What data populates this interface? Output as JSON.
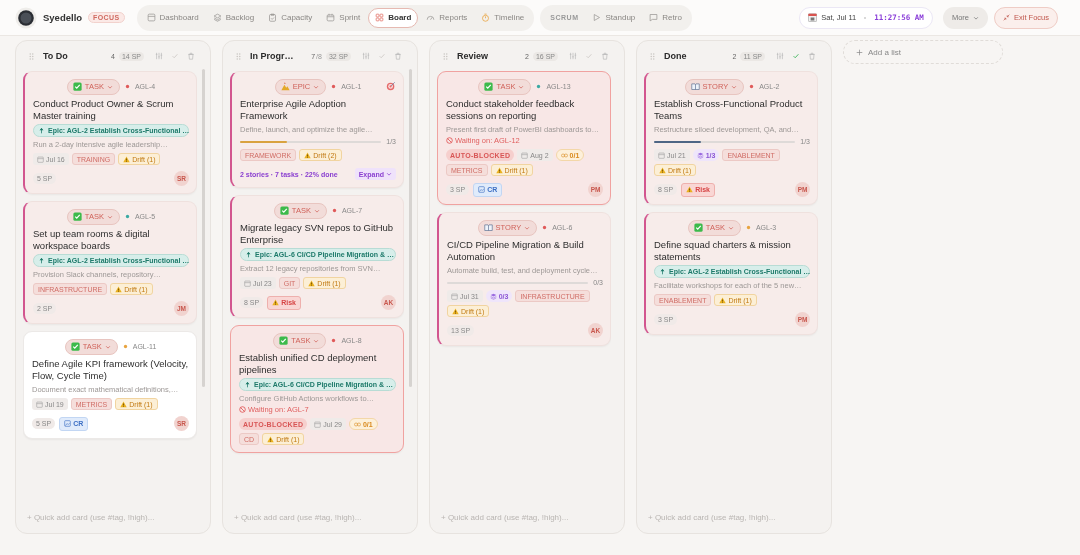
{
  "app": {
    "brand": "Syedello",
    "badge": "FOCUS"
  },
  "nav": [
    {
      "label": "Dashboard",
      "selected": false
    },
    {
      "label": "Backlog",
      "selected": false
    },
    {
      "label": "Capacity",
      "selected": false
    },
    {
      "label": "Sprint",
      "selected": false
    },
    {
      "label": "Board",
      "selected": true
    },
    {
      "label": "Reports",
      "selected": false
    },
    {
      "label": "Timeline",
      "selected": false
    }
  ],
  "scrum": {
    "label": "SCRUM",
    "items": [
      {
        "label": "Standup"
      },
      {
        "label": "Retro"
      }
    ]
  },
  "clock": {
    "date": "Sat, Jul 11",
    "time": "11:27:56 AM"
  },
  "more": "More",
  "exit": "Exit Focus",
  "columns": [
    {
      "title": "To Do",
      "count": "4",
      "points": "14 SP",
      "done": false,
      "scrolls": true,
      "quick_add": {
        "placeholder": "+ Quick add card (use #tag, !high)..."
      },
      "cards": [
        {
          "type": "TASK",
          "kind": "task",
          "color": "#e05a5a",
          "id": "AGL-4",
          "blocked": false,
          "selected": false,
          "title": "Conduct Product Owner & Scrum Master training",
          "epic": "Epic: AGL-2 Establish Cross-Functional …",
          "description": "Run a 2-day intensive agile leadership…",
          "chips": [
            {
              "kind": "date",
              "text": "Jul 16"
            },
            {
              "kind": "tag",
              "text": "TRAINING"
            },
            {
              "kind": "drift",
              "text": "Drift (1)"
            }
          ],
          "points": "5 SP",
          "avatar": "SR"
        },
        {
          "type": "TASK",
          "kind": "task",
          "color": "#3aa9a3",
          "id": "AGL-5",
          "blocked": false,
          "selected": false,
          "title": "Set up team rooms & digital workspace boards",
          "epic": "Epic: AGL-2 Establish Cross-Functional …",
          "description": "Provision Slack channels, repository…",
          "chips": [
            {
              "kind": "tag",
              "text": "INFRASTRUCTURE"
            },
            {
              "kind": "drift",
              "text": "Drift (1)"
            }
          ],
          "points": "2 SP",
          "avatar": "JM"
        },
        {
          "type": "TASK",
          "kind": "task",
          "color": "#e8a440",
          "id": "AGL-11",
          "blocked": false,
          "selected": true,
          "title": "Define Agile KPI framework (Velocity, Flow, Cycle Time)",
          "description": "Document exact mathematical definitions,…",
          "chips": [
            {
              "kind": "date",
              "text": "Jul 19"
            },
            {
              "kind": "tag",
              "text": "METRICS"
            },
            {
              "kind": "drift",
              "text": "Drift (1)"
            }
          ],
          "points": "5 SP",
          "badges": [
            {
              "kind": "cr",
              "text": "CR"
            }
          ],
          "avatar": "SR"
        }
      ]
    },
    {
      "title": "In Progr…",
      "count": "7",
      "limit": "/8",
      "points": "32 SP",
      "done": false,
      "scrolls": true,
      "quick_add": {
        "placeholder": "+ Quick add card (use #tag, !high)..."
      },
      "cards": [
        {
          "type": "EPIC",
          "kind": "epic",
          "color": "#e05a5a",
          "id": "AGL-1",
          "blocked": false,
          "selected": false,
          "title": "Enterprise Agile Adoption Framework",
          "description": "Define, launch, and optimize the agile…",
          "progress": {
            "level": 0.33,
            "text": "1/3"
          },
          "chips": [
            {
              "kind": "tag",
              "text": "FRAMEWORK"
            },
            {
              "kind": "drift",
              "text": "Drift (2)"
            }
          ],
          "summary": {
            "text": "2 stories · 7 tasks · 22% done",
            "action": "Expand"
          }
        },
        {
          "type": "TASK",
          "kind": "task",
          "color": "#e05a5a",
          "id": "AGL-7",
          "blocked": false,
          "selected": false,
          "title": "Migrate legacy SVN repos to GitHub Enterprise",
          "epic": "Epic: AGL-6 CI/CD Pipeline Migration & …",
          "description": "Extract 12 legacy repositories from SVN…",
          "chips": [
            {
              "kind": "date",
              "text": "Jul 23"
            },
            {
              "kind": "tag",
              "text": "GIT"
            },
            {
              "kind": "drift",
              "text": "Drift (1)"
            }
          ],
          "points": "8 SP",
          "badges": [
            {
              "kind": "risk",
              "text": "Risk"
            }
          ],
          "avatar": "AK"
        },
        {
          "type": "TASK",
          "kind": "task",
          "color": "#e05a5a",
          "id": "AGL-8",
          "blocked": true,
          "selected": false,
          "title": "Establish unified CD deployment pipelines",
          "epic": "Epic: AGL-6 CI/CD Pipeline Migration & …",
          "description": "Configure GitHub Actions workflows to…",
          "waiting": "Waiting on: AGL-7",
          "chips": [
            {
              "kind": "blocked",
              "text": "AUTO-BLOCKED"
            },
            {
              "kind": "date",
              "text": "Jul 29"
            },
            {
              "kind": "deps",
              "text": "0/1"
            },
            {
              "kind": "tag",
              "text": "CD"
            },
            {
              "kind": "drift",
              "text": "Drift (1)"
            }
          ]
        }
      ]
    },
    {
      "title": "Review",
      "count": "2",
      "points": "16 SP",
      "done": false,
      "scrolls": false,
      "quick_add": {
        "placeholder": "+ Quick add card (use #tag, !high)..."
      },
      "cards": [
        {
          "type": "TASK",
          "kind": "task",
          "color": "#3aa9a3",
          "id": "AGL-13",
          "blocked": true,
          "selected": false,
          "title": "Conduct stakeholder feedback sessions on reporting",
          "description": "Present first draft of PowerBI dashboards to…",
          "waiting": "Waiting on: AGL-12",
          "chips": [
            {
              "kind": "blocked",
              "text": "AUTO-BLOCKED"
            },
            {
              "kind": "date",
              "text": "Aug 2"
            },
            {
              "kind": "deps",
              "text": "0/1"
            },
            {
              "kind": "tag",
              "text": "METRICS"
            },
            {
              "kind": "drift",
              "text": "Drift (1)"
            }
          ],
          "points": "3 SP",
          "badges": [
            {
              "kind": "cr",
              "text": "CR"
            }
          ],
          "avatar": "PM"
        },
        {
          "type": "STORY",
          "kind": "story",
          "color": "#e05a5a",
          "id": "AGL-6",
          "blocked": false,
          "selected": false,
          "title": "CI/CD Pipeline Migration & Build Automation",
          "description": "Automate build, test, and deployment cycle…",
          "progress": {
            "text": "0/3"
          },
          "chips": [
            {
              "kind": "date",
              "text": "Jul 31"
            },
            {
              "kind": "subtasks",
              "text": "0/3"
            },
            {
              "kind": "tag",
              "text": "INFRASTRUCTURE"
            },
            {
              "kind": "drift",
              "text": "Drift (1)"
            }
          ],
          "points": "13 SP",
          "avatar": "AK"
        }
      ]
    },
    {
      "title": "Done",
      "count": "2",
      "points": "11 SP",
      "done": true,
      "scrolls": false,
      "quick_add": {
        "placeholder": "+ Quick add card (use #tag, !high)..."
      },
      "cards": [
        {
          "type": "STORY",
          "kind": "story",
          "color": "#e05a5a",
          "id": "AGL-2",
          "blocked": false,
          "selected": false,
          "title": "Establish Cross-Functional Product Teams",
          "description": "Restructure siloed development, QA, and…",
          "progress": {
            "level": 0.33,
            "text": "1/3"
          },
          "chips": [
            {
              "kind": "date",
              "text": "Jul 21"
            },
            {
              "kind": "subtasks",
              "text": "1/3"
            },
            {
              "kind": "tag",
              "text": "ENABLEMENT"
            },
            {
              "kind": "drift",
              "text": "Drift (1)"
            }
          ],
          "points": "8 SP",
          "badges": [
            {
              "kind": "risk",
              "text": "Risk"
            }
          ],
          "avatar": "PM"
        },
        {
          "type": "TASK",
          "kind": "task",
          "color": "#e8a440",
          "id": "AGL-3",
          "blocked": false,
          "selected": false,
          "title": "Define squad charters & mission statements",
          "epic": "Epic: AGL-2 Establish Cross-Functional …",
          "description": "Facilitate workshops for each of the 5 new…",
          "chips": [
            {
              "kind": "tag",
              "text": "ENABLEMENT"
            },
            {
              "kind": "drift",
              "text": "Drift (1)"
            }
          ],
          "points": "3 SP",
          "avatar": "PM"
        }
      ]
    }
  ],
  "add_list": "Add a list"
}
